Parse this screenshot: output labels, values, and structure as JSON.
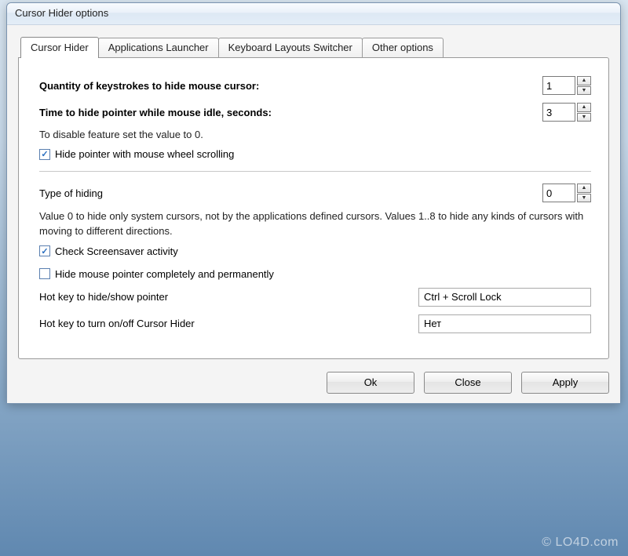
{
  "window": {
    "title": "Cursor Hider options"
  },
  "tabs": [
    {
      "label": "Cursor Hider",
      "active": true
    },
    {
      "label": "Applications Launcher",
      "active": false
    },
    {
      "label": "Keyboard Layouts Switcher",
      "active": false
    },
    {
      "label": "Other options",
      "active": false
    }
  ],
  "content": {
    "keystrokes_label": "Quantity of keystrokes to hide mouse cursor:",
    "keystrokes_value": "1",
    "idle_label": "Time to hide pointer while mouse idle, seconds:",
    "idle_value": "3",
    "disable_note": "To disable feature set the value to 0.",
    "chk_wheel_label": "Hide pointer with mouse wheel scrolling",
    "chk_wheel_checked": true,
    "type_label": "Type of hiding",
    "type_value": "0",
    "type_desc": "Value 0 to hide only system cursors, not by the applications defined cursors. Values 1..8 to hide any kinds of cursors with moving to different directions.",
    "chk_screensaver_label": "Check Screensaver activity",
    "chk_screensaver_checked": true,
    "chk_permanent_label": "Hide mouse pointer completely and permanently",
    "chk_permanent_checked": false,
    "hotkey_show_label": "Hot key to hide/show pointer",
    "hotkey_show_value": "Ctrl + Scroll Lock",
    "hotkey_toggle_label": "Hot key to turn on/off Cursor Hider",
    "hotkey_toggle_value": "Нет"
  },
  "buttons": {
    "ok": "Ok",
    "close": "Close",
    "apply": "Apply"
  },
  "watermark": "© LO4D.com"
}
